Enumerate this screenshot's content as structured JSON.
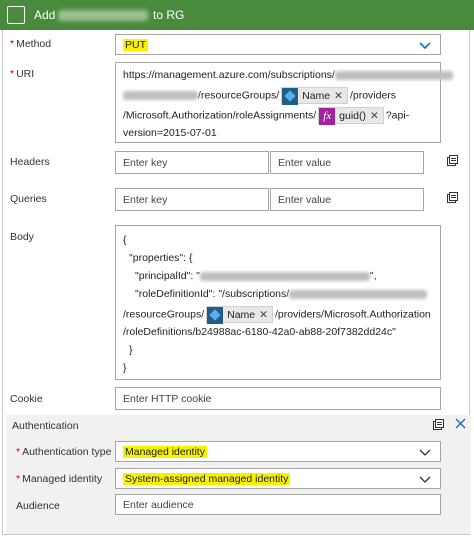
{
  "header": {
    "title_prefix": "Add",
    "title_suffix": "to RG"
  },
  "method": {
    "label": "Method",
    "value": "PUT"
  },
  "uri": {
    "label": "URI",
    "line1_prefix": "https://management.azure.com/subscriptions/",
    "line2_prefix": "/resourceGroups/",
    "token_name": "Name",
    "line2_suffix": "/providers",
    "line3_prefix": "/Microsoft.Authorization/roleAssignments/",
    "token_guid": "guid()",
    "line3_suffix": "?api-",
    "line4": "version=2015-07-01"
  },
  "headers": {
    "label": "Headers",
    "key_placeholder": "Enter key",
    "value_placeholder": "Enter value"
  },
  "queries": {
    "label": "Queries",
    "key_placeholder": "Enter key",
    "value_placeholder": "Enter value"
  },
  "body": {
    "label": "Body",
    "l1": "{",
    "l2": "\"properties\": {",
    "l3_prefix": "\"principalId\": \"",
    "l3_suffix": "\",",
    "l4_prefix": "\"roleDefinitionId\": \"/subscriptions/",
    "l5_prefix": "/resourceGroups/",
    "token_name": "Name",
    "l5_suffix": "/providers/Microsoft.Authorization",
    "l6": "/roleDefinitions/b24988ac-6180-42a0-ab88-20f7382dd24c\"",
    "l7": "}",
    "l8": "}"
  },
  "cookie": {
    "label": "Cookie",
    "placeholder": "Enter HTTP cookie"
  },
  "authentication": {
    "label": "Authentication",
    "type_label": "Authentication type",
    "type_value": "Managed identity",
    "identity_label": "Managed identity",
    "identity_value": "System-assigned managed identity",
    "audience_label": "Audience",
    "audience_placeholder": "Enter audience"
  },
  "colors": {
    "header_bg": "#4a8a3c",
    "highlight": "#f8f200",
    "chevron": "#1f6fbf"
  }
}
